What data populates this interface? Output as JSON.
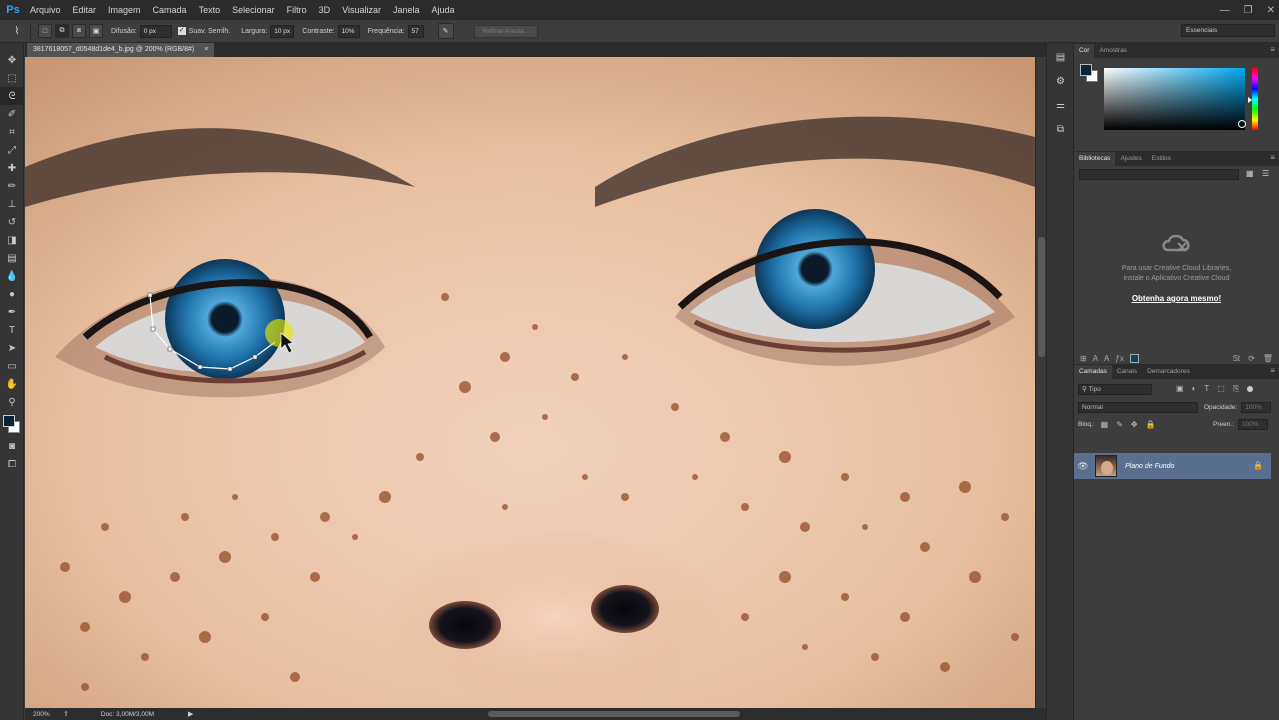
{
  "app": {
    "logo": "Ps"
  },
  "menu": [
    "Arquivo",
    "Editar",
    "Imagem",
    "Camada",
    "Texto",
    "Selecionar",
    "Filtro",
    "3D",
    "Visualizar",
    "Janela",
    "Ajuda"
  ],
  "window_controls": {
    "minimize": "—",
    "restore": "❐",
    "close": "✕"
  },
  "options": {
    "feather_label": "Difusão:",
    "feather_value": "0 px",
    "antialias_label": "Suav. Serrilh.",
    "width_label": "Largura:",
    "width_value": "10 px",
    "contrast_label": "Contraste:",
    "contrast_value": "10%",
    "frequency_label": "Frequência:",
    "frequency_value": "57",
    "refine_edge": "Refinar Aresta...",
    "workspace": "Essenciais"
  },
  "document": {
    "tab_title": "3817618057_d0548d1de4_b.jpg @ 200% (RGB/8#)",
    "tab_close": "×"
  },
  "status": {
    "zoom": "200%",
    "doc_info": "Doc: 3,00M/3,00M"
  },
  "color_panel": {
    "tabs": [
      "Cor",
      "Amostras"
    ],
    "foreground": "#0b2437",
    "background": "#ffffff"
  },
  "libraries_panel": {
    "tabs": [
      "Bibliotecas",
      "Ajustes",
      "Estilos"
    ],
    "message": "Para usar Creative Cloud Libraries,\ninstale o Aplicativo Creative Cloud",
    "link": "Obtenha agora mesmo!"
  },
  "layers_panel": {
    "tabs": [
      "Camadas",
      "Canais",
      "Demarcadores"
    ],
    "filter": "Tipo",
    "blend_mode": "Normal",
    "opacity_label": "Opacidade:",
    "opacity_value": "100%",
    "lock_label": "Bloq.:",
    "fill_label": "Preen.:",
    "fill_value": "100%",
    "layers": [
      {
        "name": "Plano de Fundo",
        "visible": true,
        "locked": true
      }
    ]
  },
  "colors": {
    "menubar": "#2b2b2b",
    "panel": "#3d3d3d",
    "selected_layer": "#5a6e8f",
    "ps_blue": "#2fa3f6"
  }
}
